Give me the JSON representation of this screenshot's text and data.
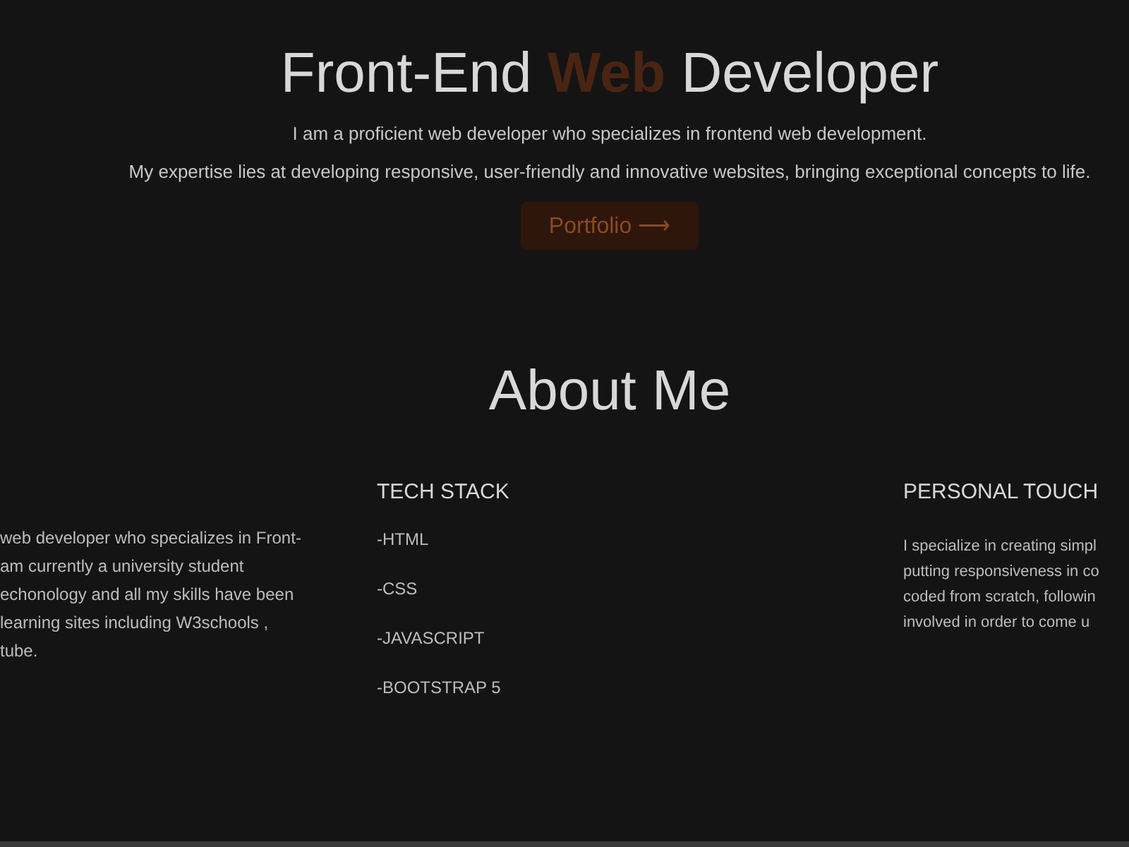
{
  "hero": {
    "title_parts": [
      {
        "text": "Front-End",
        "accent": false
      },
      {
        "text": "Web",
        "accent": true
      },
      {
        "text": "Developer",
        "accent": false
      }
    ],
    "paragraphs": [
      "I am a proficient web developer who specializes in frontend web development.",
      "My expertise lies at developing responsive, user-friendly and innovative websites, bringing exceptional concepts to life."
    ],
    "button": {
      "label": "Portfolio",
      "arrow": "⟶"
    }
  },
  "about": {
    "title": "About Me",
    "columns": [
      {
        "kind": "text",
        "lines": [
          "web developer who specializes in Front-",
          "am currently a university student",
          "echonology and all my skills have been",
          "learning sites including W3schools ,",
          "tube."
        ]
      },
      {
        "kind": "list",
        "heading": "TECH STACK",
        "items": [
          "-HTML",
          "-CSS",
          "-JAVASCRIPT",
          "-BOOTSTRAP 5"
        ]
      },
      {
        "kind": "text",
        "heading": "PERSONAL TOUCH",
        "lines": [
          "I specialize in creating simpl",
          "putting responsiveness in co",
          "coded from scratch, followin",
          "involved in order to come u"
        ]
      }
    ]
  }
}
